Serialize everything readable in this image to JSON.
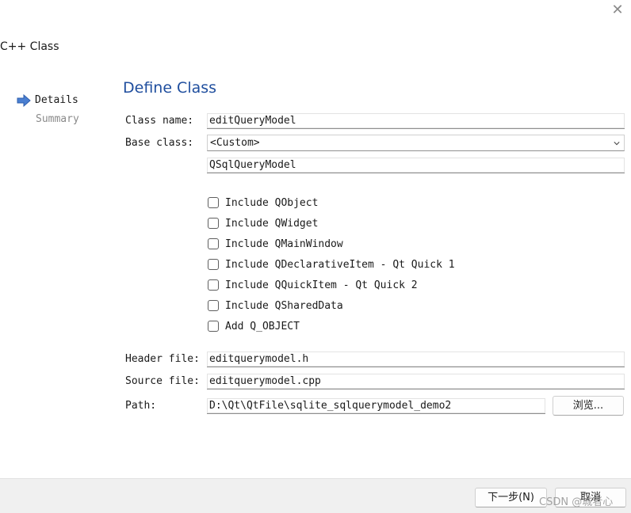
{
  "window": {
    "title": "C++ Class",
    "close_glyph": "✕"
  },
  "steps": [
    {
      "label": "Details",
      "active": true
    },
    {
      "label": "Summary",
      "active": false
    }
  ],
  "page_title": "Define Class",
  "form": {
    "class_name_label": "Class name:",
    "class_name_value": "editQueryModel",
    "base_class_label": "Base class:",
    "base_class_selected": "<Custom>",
    "base_class_custom_value": "QSqlQueryModel",
    "options": [
      {
        "label": "Include QObject",
        "checked": false
      },
      {
        "label": "Include QWidget",
        "checked": false
      },
      {
        "label": "Include QMainWindow",
        "checked": false
      },
      {
        "label": "Include QDeclarativeItem - Qt Quick 1",
        "checked": false
      },
      {
        "label": "Include QQuickItem - Qt Quick 2",
        "checked": false
      },
      {
        "label": "Include QSharedData",
        "checked": false
      },
      {
        "label": "Add Q_OBJECT",
        "checked": false
      }
    ],
    "header_file_label": "Header file:",
    "header_file_value": "editquerymodel.h",
    "source_file_label": "Source file:",
    "source_file_value": "editquerymodel.cpp",
    "path_label": "Path:",
    "path_value": "D:\\Qt\\QtFile\\sqlite_sqlquerymodel_demo2",
    "browse_label": "浏览..."
  },
  "footer": {
    "next_label": "下一步(N)",
    "cancel_label": "取消"
  },
  "watermark": "CSDN @城者心",
  "colors": {
    "title": "#1f4e9e",
    "step_arrow": "#4a7fd1",
    "footer_bg": "#f0f0f0"
  },
  "icons": {
    "close": "close-icon",
    "step_arrow": "arrow-right-icon",
    "combo_arrow": "chevron-down-icon"
  }
}
